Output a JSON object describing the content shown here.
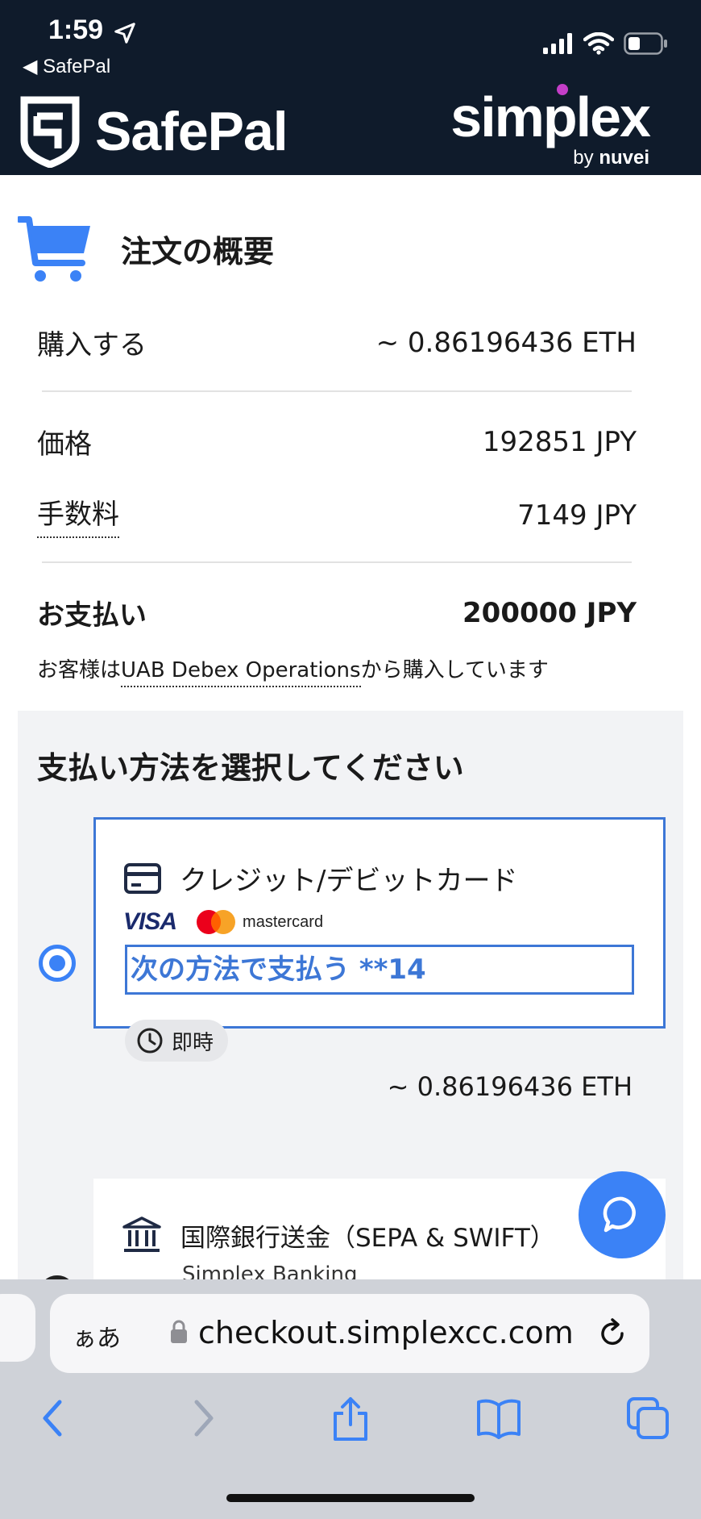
{
  "status_bar": {
    "time": "1:59",
    "back_app": "◀ SafePal",
    "icons": [
      "location-arrow-icon",
      "signal-icon",
      "wifi-icon",
      "battery-icon"
    ]
  },
  "brand": {
    "left_name": "SafePal",
    "right_name": "simplex",
    "right_by": "by",
    "right_parent": "nuvei"
  },
  "order_summary": {
    "title": "注文の概要",
    "buy_label": "購入する",
    "buy_value": "~ 0.86196436 ETH",
    "price_label": "価格",
    "price_value": "192851 JPY",
    "fee_label": "手数料",
    "fee_value": "7149 JPY",
    "total_label": "お支払い",
    "total_value": "200000 JPY",
    "merchant_prefix": "お客様は",
    "merchant_name": "UAB Debex Operations",
    "merchant_suffix": "から購入しています"
  },
  "payment": {
    "title": "支払い方法を選択してください",
    "card_option": {
      "selected": true,
      "title": "クレジット/デビットカード",
      "visa_label": "VISA",
      "mastercard_label": "mastercard",
      "pay_with": "次の方法で支払う **14",
      "speed": "即時",
      "amount": "~ 0.86196436 ETH"
    },
    "bank_option": {
      "selected": false,
      "title": "国際銀行送金（SEPA & SWIFT）",
      "subtitle": "Simplex Banking"
    }
  },
  "browser": {
    "aa_label": "ぁあ",
    "url": "checkout.simplexcc.com"
  },
  "colors": {
    "header_bg": "#0f1b2b",
    "accent": "#3b82f6",
    "option_border": "#3d77d6",
    "section_bg": "#f2f3f5",
    "toolbar_bg": "#cfd2d8"
  }
}
